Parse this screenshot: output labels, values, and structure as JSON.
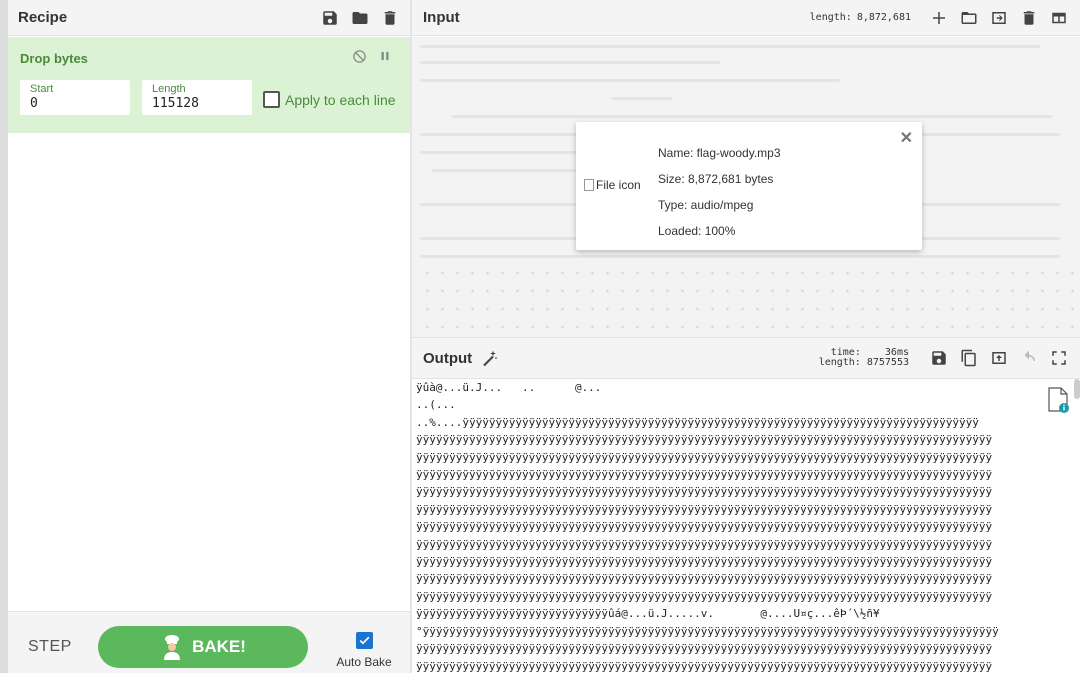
{
  "recipe": {
    "title": "Recipe",
    "operation": {
      "name": "Drop bytes",
      "start_label": "Start",
      "start_value": "0",
      "length_label": "Length",
      "length_value": "115128",
      "apply_label": "Apply to each line"
    },
    "footer": {
      "step_label": "STEP",
      "bake_label": "BAKE!",
      "autobake_label": "Auto Bake"
    }
  },
  "input": {
    "title": "Input",
    "length_label": "length:",
    "length_value": "8,872,681",
    "file": {
      "icon_alt": "File icon",
      "name": "Name: flag-woody.mp3",
      "size": "Size: 8,872,681 bytes",
      "type": "Type: audio/mpeg",
      "loaded": "Loaded: 100%"
    }
  },
  "output": {
    "title": "Output",
    "time_label": "time:",
    "time_value": "36ms",
    "length_label": "length:",
    "length_value": "8757553",
    "lines": [
      "ÿûà@...ü.J...   ..      @...",
      "..(...",
      "..%....ÿÿÿÿÿÿÿÿÿÿÿÿÿÿÿÿÿÿÿÿÿÿÿÿÿÿÿÿÿÿÿÿÿÿÿÿÿÿÿÿÿÿÿÿÿÿÿÿÿÿÿÿÿÿÿÿÿÿÿÿÿÿÿÿÿÿÿÿÿÿÿÿÿÿÿÿÿÿ",
      "ÿÿÿÿÿÿÿÿÿÿÿÿÿÿÿÿÿÿÿÿÿÿÿÿÿÿÿÿÿÿÿÿÿÿÿÿÿÿÿÿÿÿÿÿÿÿÿÿÿÿÿÿÿÿÿÿÿÿÿÿÿÿÿÿÿÿÿÿÿÿÿÿÿÿÿÿÿÿÿÿÿÿÿÿÿÿÿ",
      "ÿÿÿÿÿÿÿÿÿÿÿÿÿÿÿÿÿÿÿÿÿÿÿÿÿÿÿÿÿÿÿÿÿÿÿÿÿÿÿÿÿÿÿÿÿÿÿÿÿÿÿÿÿÿÿÿÿÿÿÿÿÿÿÿÿÿÿÿÿÿÿÿÿÿÿÿÿÿÿÿÿÿÿÿÿÿÿ",
      "ÿÿÿÿÿÿÿÿÿÿÿÿÿÿÿÿÿÿÿÿÿÿÿÿÿÿÿÿÿÿÿÿÿÿÿÿÿÿÿÿÿÿÿÿÿÿÿÿÿÿÿÿÿÿÿÿÿÿÿÿÿÿÿÿÿÿÿÿÿÿÿÿÿÿÿÿÿÿÿÿÿÿÿÿÿÿÿ",
      "ÿÿÿÿÿÿÿÿÿÿÿÿÿÿÿÿÿÿÿÿÿÿÿÿÿÿÿÿÿÿÿÿÿÿÿÿÿÿÿÿÿÿÿÿÿÿÿÿÿÿÿÿÿÿÿÿÿÿÿÿÿÿÿÿÿÿÿÿÿÿÿÿÿÿÿÿÿÿÿÿÿÿÿÿÿÿÿ",
      "ÿÿÿÿÿÿÿÿÿÿÿÿÿÿÿÿÿÿÿÿÿÿÿÿÿÿÿÿÿÿÿÿÿÿÿÿÿÿÿÿÿÿÿÿÿÿÿÿÿÿÿÿÿÿÿÿÿÿÿÿÿÿÿÿÿÿÿÿÿÿÿÿÿÿÿÿÿÿÿÿÿÿÿÿÿÿÿ",
      "ÿÿÿÿÿÿÿÿÿÿÿÿÿÿÿÿÿÿÿÿÿÿÿÿÿÿÿÿÿÿÿÿÿÿÿÿÿÿÿÿÿÿÿÿÿÿÿÿÿÿÿÿÿÿÿÿÿÿÿÿÿÿÿÿÿÿÿÿÿÿÿÿÿÿÿÿÿÿÿÿÿÿÿÿÿÿÿ",
      "ÿÿÿÿÿÿÿÿÿÿÿÿÿÿÿÿÿÿÿÿÿÿÿÿÿÿÿÿÿÿÿÿÿÿÿÿÿÿÿÿÿÿÿÿÿÿÿÿÿÿÿÿÿÿÿÿÿÿÿÿÿÿÿÿÿÿÿÿÿÿÿÿÿÿÿÿÿÿÿÿÿÿÿÿÿÿÿ",
      "ÿÿÿÿÿÿÿÿÿÿÿÿÿÿÿÿÿÿÿÿÿÿÿÿÿÿÿÿÿÿÿÿÿÿÿÿÿÿÿÿÿÿÿÿÿÿÿÿÿÿÿÿÿÿÿÿÿÿÿÿÿÿÿÿÿÿÿÿÿÿÿÿÿÿÿÿÿÿÿÿÿÿÿÿÿÿÿ",
      "ÿÿÿÿÿÿÿÿÿÿÿÿÿÿÿÿÿÿÿÿÿÿÿÿÿÿÿÿÿÿÿÿÿÿÿÿÿÿÿÿÿÿÿÿÿÿÿÿÿÿÿÿÿÿÿÿÿÿÿÿÿÿÿÿÿÿÿÿÿÿÿÿÿÿÿÿÿÿÿÿÿÿÿÿÿÿÿ",
      "ÿÿÿÿÿÿÿÿÿÿÿÿÿÿÿÿÿÿÿÿÿÿÿÿÿÿÿÿÿÿÿÿÿÿÿÿÿÿÿÿÿÿÿÿÿÿÿÿÿÿÿÿÿÿÿÿÿÿÿÿÿÿÿÿÿÿÿÿÿÿÿÿÿÿÿÿÿÿÿÿÿÿÿÿÿÿÿ",
      "ÿÿÿÿÿÿÿÿÿÿÿÿÿÿÿÿÿÿÿÿÿÿÿÿÿÿÿÿÿûá@...ü.J.....v.       @....U¤ç...êÞ´\\½ñ¥",
      "°ÿÿÿÿÿÿÿÿÿÿÿÿÿÿÿÿÿÿÿÿÿÿÿÿÿÿÿÿÿÿÿÿÿÿÿÿÿÿÿÿÿÿÿÿÿÿÿÿÿÿÿÿÿÿÿÿÿÿÿÿÿÿÿÿÿÿÿÿÿÿÿÿÿÿÿÿÿÿÿÿÿÿÿÿÿÿÿ",
      "ÿÿÿÿÿÿÿÿÿÿÿÿÿÿÿÿÿÿÿÿÿÿÿÿÿÿÿÿÿÿÿÿÿÿÿÿÿÿÿÿÿÿÿÿÿÿÿÿÿÿÿÿÿÿÿÿÿÿÿÿÿÿÿÿÿÿÿÿÿÿÿÿÿÿÿÿÿÿÿÿÿÿÿÿÿÿÿ",
      "ÿÿÿÿÿÿÿÿÿÿÿÿÿÿÿÿÿÿÿÿÿÿÿÿÿÿÿÿÿÿÿÿÿÿÿÿÿÿÿÿÿÿÿÿÿÿÿÿÿÿÿÿÿÿÿÿÿÿÿÿÿÿÿÿÿÿÿÿÿÿÿÿÿÿÿÿÿÿÿÿÿÿÿÿÿÿÿ"
    ]
  },
  "colors": {
    "op_background": "#dcf2d4",
    "op_text": "#4a8a3c",
    "bake_button": "#5cb85c",
    "autobake_check": "#1a73d0"
  }
}
